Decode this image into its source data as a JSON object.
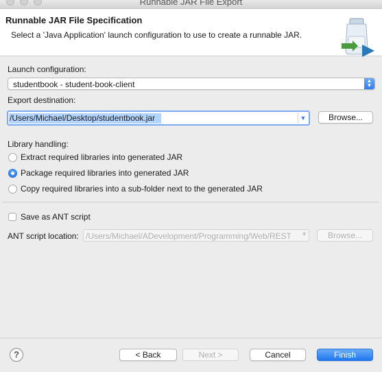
{
  "window": {
    "title": "Runnable JAR File Export"
  },
  "header": {
    "title": "Runnable JAR File Specification",
    "description": "Select a 'Java Application' launch configuration to use to create a runnable JAR.",
    "icon": "jar-export-icon"
  },
  "launch": {
    "label": "Launch configuration:",
    "selected": "studentbook - student-book-client"
  },
  "export": {
    "label": "Export destination:",
    "value": "/Users/Michael/Desktop/studentbook.jar",
    "browse_label": "Browse..."
  },
  "library": {
    "label": "Library handling:",
    "options": [
      {
        "label": "Extract required libraries into generated JAR",
        "selected": false
      },
      {
        "label": "Package required libraries into generated JAR",
        "selected": true
      },
      {
        "label": "Copy required libraries into a sub-folder next to the generated JAR",
        "selected": false
      }
    ]
  },
  "ant": {
    "save_label": "Save as ANT script",
    "save_checked": false,
    "location_label": "ANT script location:",
    "location_value": "/Users/Michael/ADevelopment/Programming/Web/REST",
    "browse_label": "Browse..."
  },
  "footer": {
    "help_label": "?",
    "back_label": "< Back",
    "next_label": "Next >",
    "cancel_label": "Cancel",
    "finish_label": "Finish"
  },
  "colors": {
    "accent": "#2f7ef1",
    "selection": "#b3d4fd"
  }
}
